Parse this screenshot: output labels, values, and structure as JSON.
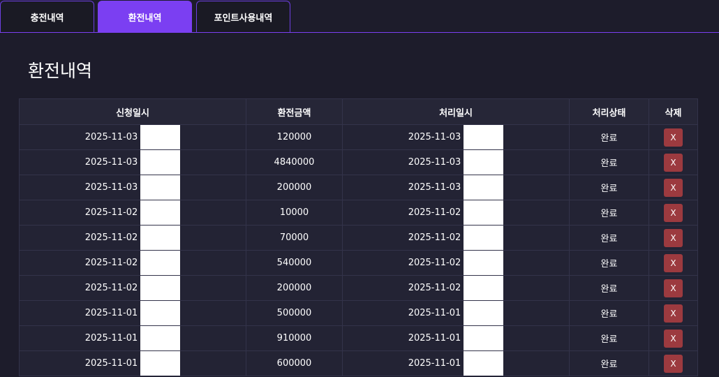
{
  "tabs": [
    {
      "label": "충전내역",
      "active": false
    },
    {
      "label": "환전내역",
      "active": true
    },
    {
      "label": "포인트사용내역",
      "active": false
    }
  ],
  "page_title": "환전내역",
  "table": {
    "headers": [
      "신청일시",
      "환전금액",
      "처리일시",
      "처리상태",
      "삭제"
    ],
    "rows": [
      {
        "request_date": "2025-11-03",
        "amount": "120000",
        "process_date": "2025-11-03",
        "status": "완료",
        "delete_label": "X"
      },
      {
        "request_date": "2025-11-03",
        "amount": "4840000",
        "process_date": "2025-11-03",
        "status": "완료",
        "delete_label": "X"
      },
      {
        "request_date": "2025-11-03",
        "amount": "200000",
        "process_date": "2025-11-03",
        "status": "완료",
        "delete_label": "X"
      },
      {
        "request_date": "2025-11-02",
        "amount": "10000",
        "process_date": "2025-11-02",
        "status": "완료",
        "delete_label": "X"
      },
      {
        "request_date": "2025-11-02",
        "amount": "70000",
        "process_date": "2025-11-02",
        "status": "완료",
        "delete_label": "X"
      },
      {
        "request_date": "2025-11-02",
        "amount": "540000",
        "process_date": "2025-11-02",
        "status": "완료",
        "delete_label": "X"
      },
      {
        "request_date": "2025-11-02",
        "amount": "200000",
        "process_date": "2025-11-02",
        "status": "완료",
        "delete_label": "X"
      },
      {
        "request_date": "2025-11-01",
        "amount": "500000",
        "process_date": "2025-11-01",
        "status": "완료",
        "delete_label": "X"
      },
      {
        "request_date": "2025-11-01",
        "amount": "910000",
        "process_date": "2025-11-01",
        "status": "완료",
        "delete_label": "X"
      },
      {
        "request_date": "2025-11-01",
        "amount": "600000",
        "process_date": "2025-11-01",
        "status": "완료",
        "delete_label": "X"
      }
    ]
  },
  "colors": {
    "background": "#1d1c2b",
    "accent": "#7b3ff2",
    "delete_button": "#9c3a3f"
  }
}
